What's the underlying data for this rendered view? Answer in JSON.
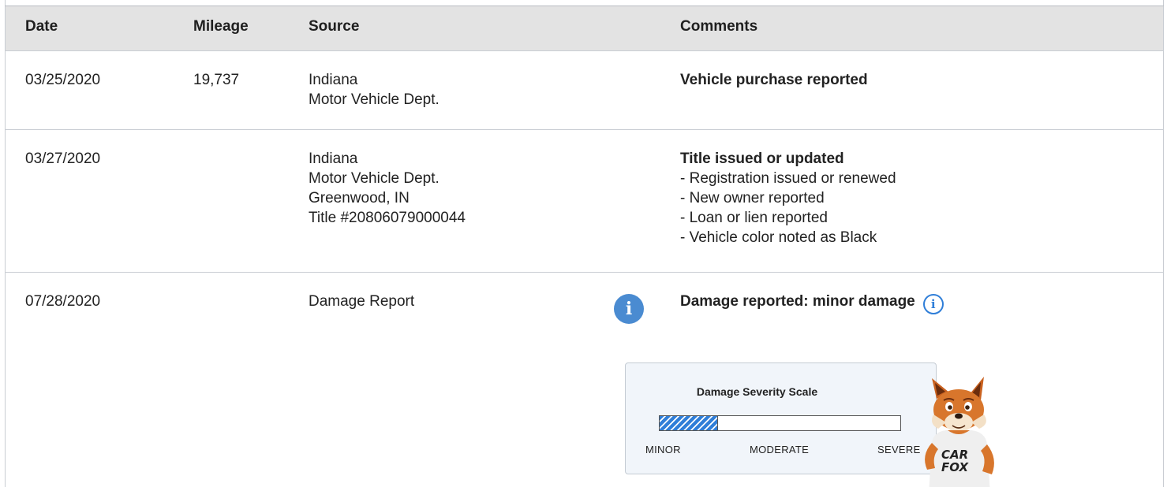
{
  "header": {
    "date": "Date",
    "mileage": "Mileage",
    "source": "Source",
    "comments": "Comments"
  },
  "rows": [
    {
      "date": "03/25/2020",
      "mileage": "19,737",
      "source": [
        "Indiana",
        "Motor Vehicle Dept."
      ],
      "comment_title": "Vehicle purchase reported",
      "comment_lines": []
    },
    {
      "date": "03/27/2020",
      "mileage": "",
      "source": [
        "Indiana",
        "Motor Vehicle Dept.",
        "Greenwood, IN",
        "Title #20806079000044"
      ],
      "comment_title": "Title issued or updated",
      "comment_lines": [
        "- Registration issued or renewed",
        "- New owner reported",
        "- Loan or lien reported",
        "- Vehicle color noted as Black"
      ]
    },
    {
      "date": "07/28/2020",
      "mileage": "",
      "source": [
        "Damage Report"
      ],
      "comment_title": "Damage reported: minor damage",
      "comment_lines": []
    }
  ],
  "icons": {
    "source_info": "info-icon",
    "comment_info": "info-outline-icon",
    "mascot": "carfox-mascot"
  },
  "severity_scale": {
    "title": "Damage Severity Scale",
    "labels": [
      "MINOR",
      "MODERATE",
      "SEVERE"
    ],
    "level_fraction": 0.24,
    "fill_color": "#2f7ed8"
  },
  "mascot_shirt_text": "CAR FOX"
}
